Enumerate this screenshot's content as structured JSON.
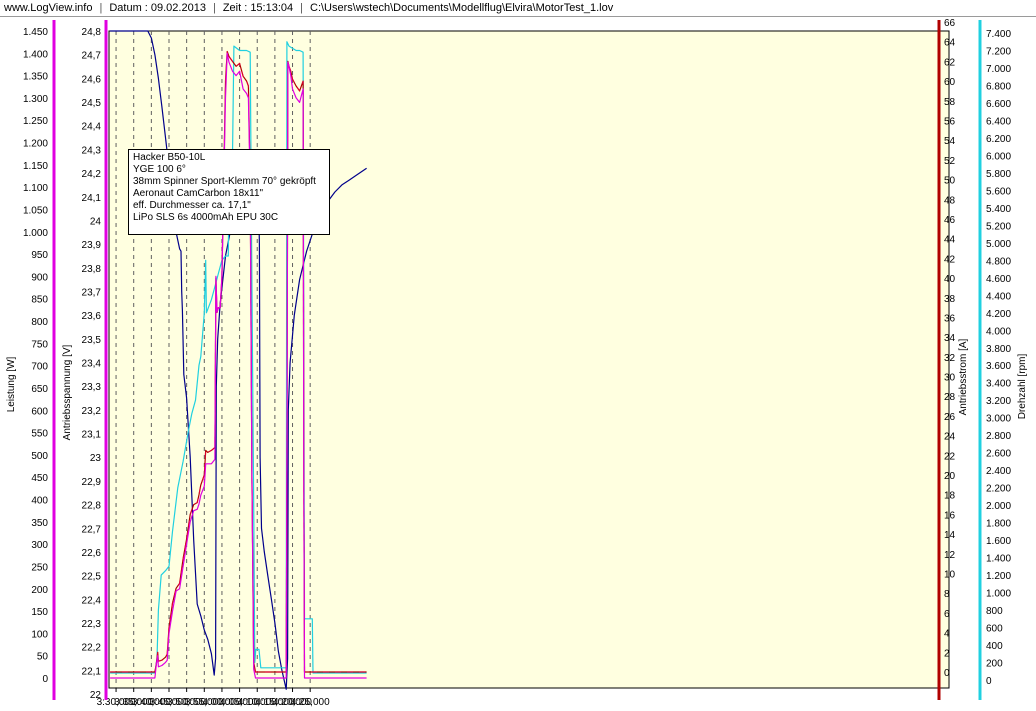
{
  "header": {
    "site": "www.LogView.info",
    "date": "Datum : 09.02.2013",
    "time": "Zeit : 15:13:04",
    "path": "C:\\Users\\wstech\\Documents\\Modellflug\\Elvira\\MotorTest_1.lov"
  },
  "infobox": {
    "lines": [
      "Hacker B50-10L",
      "YGE 100 6°",
      "38mm Spinner Sport-Klemm 70° gekröpft",
      "Aeronaut CamCarbon 18x11\"",
      "eff. Durchmesser ca. 17,1\"",
      "LiPo SLS 6s 4000mAh EPU 30C"
    ]
  },
  "colors": {
    "plot_bg": "#FFFFE0",
    "power": "#E000E0",
    "voltage": "#00008B",
    "current": "#B00000",
    "current_dash": "#FF0050",
    "rpm": "#20D0E0",
    "grid": "#606060"
  },
  "chart_data": {
    "type": "line",
    "x_unit": "m:ss",
    "xlim": [
      208,
      446
    ],
    "x_ticks": [
      {
        "t": 210,
        "label": "3:30,000"
      },
      {
        "t": 215,
        "label": "3:35,000"
      },
      {
        "t": 220,
        "label": "3:40,000"
      },
      {
        "t": 225,
        "label": "3:45,000"
      },
      {
        "t": 230,
        "label": "3:50,000"
      },
      {
        "t": 235,
        "label": "3:55,000"
      },
      {
        "t": 240,
        "label": "4:00,000"
      },
      {
        "t": 245,
        "label": "4:05,000"
      },
      {
        "t": 250,
        "label": "4:10,000"
      },
      {
        "t": 255,
        "label": "4:15,000"
      },
      {
        "t": 260,
        "label": "4:20,000"
      },
      {
        "t": 265,
        "label": "4:25,000"
      }
    ],
    "axes": {
      "power": {
        "label": "Leistung [W]",
        "ylim": [
          0,
          1450
        ],
        "ticks": [
          0,
          50,
          100,
          150,
          200,
          250,
          300,
          350,
          400,
          450,
          500,
          550,
          600,
          650,
          700,
          750,
          800,
          850,
          900,
          950,
          "1.000",
          "1.050",
          "1.100",
          "1.150",
          "1.200",
          "1.250",
          "1.300",
          "1.350",
          "1.400",
          "1.450"
        ]
      },
      "voltage": {
        "label": "Antriebsspannung [V]",
        "ylim": [
          22.0,
          24.8
        ],
        "ticks": [
          "22",
          "22,1",
          "22,2",
          "22,3",
          "22,4",
          "22,5",
          "22,6",
          "22,7",
          "22,8",
          "22,9",
          "23",
          "23,1",
          "23,2",
          "23,3",
          "23,4",
          "23,5",
          "23,6",
          "23,7",
          "23,8",
          "23,9",
          "24",
          "24,1",
          "24,2",
          "24,3",
          "24,4",
          "24,5",
          "24,6",
          "24,7",
          "24,8"
        ]
      },
      "current": {
        "label": "Antriebsstrom [A]",
        "ylim": [
          0,
          66
        ],
        "ticks": [
          "0",
          "2",
          "4",
          "6",
          "8",
          "10",
          "12",
          "14",
          "16",
          "18",
          "20",
          "22",
          "24",
          "26",
          "28",
          "30",
          "32",
          "34",
          "36",
          "38",
          "40",
          "42",
          "44",
          "46",
          "48",
          "50",
          "52",
          "54",
          "56",
          "58",
          "60",
          "62",
          "64",
          "66"
        ]
      },
      "rpm": {
        "label": "Drehzahl [rpm]",
        "ylim": [
          0,
          7400
        ],
        "ticks": [
          "0",
          "200",
          "400",
          "600",
          "800",
          "1.000",
          "1.200",
          "1.400",
          "1.600",
          "1.800",
          "2.000",
          "2.200",
          "2.400",
          "2.600",
          "2.800",
          "3.000",
          "3.200",
          "3.400",
          "3.600",
          "3.800",
          "4.000",
          "4.200",
          "4.400",
          "4.600",
          "4.800",
          "5.000",
          "5.200",
          "5.400",
          "5.600",
          "5.800",
          "6.000",
          "6.200",
          "6.400",
          "6.600",
          "6.800",
          "7.000",
          "7.200",
          "7.400"
        ]
      }
    },
    "series": [
      {
        "key": "voltage",
        "axis": "voltage",
        "points": [
          [
            208.3,
            24.8
          ],
          [
            219,
            24.8
          ],
          [
            220,
            24.77
          ],
          [
            221,
            24.7
          ],
          [
            222,
            24.6
          ],
          [
            223,
            24.48
          ],
          [
            224,
            24.35
          ],
          [
            225,
            24.22
          ],
          [
            226,
            24.08
          ],
          [
            227,
            23.95
          ],
          [
            228,
            23.88
          ],
          [
            228.4,
            23.87
          ],
          [
            228.6,
            23.7
          ],
          [
            228.8,
            23.62
          ],
          [
            229.2,
            23.35
          ],
          [
            230,
            23.25
          ],
          [
            231,
            23.0
          ],
          [
            232,
            22.65
          ],
          [
            233,
            22.38
          ],
          [
            234,
            22.33
          ],
          [
            235,
            22.27
          ],
          [
            236,
            22.23
          ],
          [
            237,
            22.17
          ],
          [
            237.8,
            22.08
          ],
          [
            238.2,
            22.15
          ],
          [
            238.4,
            23.3
          ],
          [
            238.8,
            23.5
          ],
          [
            239.5,
            23.65
          ],
          [
            241,
            23.85
          ],
          [
            243,
            24.0
          ],
          [
            245,
            24.1
          ],
          [
            247,
            24.16
          ],
          [
            249,
            24.2
          ],
          [
            250.2,
            24.22
          ],
          [
            250.6,
            23.9
          ],
          [
            250.8,
            23.0
          ],
          [
            251.2,
            22.7
          ],
          [
            252,
            22.6
          ],
          [
            253,
            22.5
          ],
          [
            254,
            22.4
          ],
          [
            255,
            22.3
          ],
          [
            256,
            22.18
          ],
          [
            257,
            22.1
          ],
          [
            258.2,
            22.02
          ],
          [
            258.6,
            22.15
          ],
          [
            258.8,
            23.2
          ],
          [
            259.3,
            23.4
          ],
          [
            260.5,
            23.6
          ],
          [
            262,
            23.75
          ],
          [
            264,
            23.87
          ],
          [
            266,
            23.96
          ],
          [
            268,
            24.03
          ],
          [
            270,
            24.08
          ],
          [
            272,
            24.12
          ],
          [
            274,
            24.15
          ],
          [
            276,
            24.17
          ],
          [
            278,
            24.19
          ],
          [
            281,
            24.22
          ]
        ]
      },
      {
        "key": "rpm",
        "axis": "rpm",
        "points": [
          [
            208.3,
            80
          ],
          [
            221,
            80
          ],
          [
            221.6,
            250
          ],
          [
            222,
            800
          ],
          [
            222.8,
            1200
          ],
          [
            224,
            1250
          ],
          [
            225,
            1300
          ],
          [
            226,
            1700
          ],
          [
            227.5,
            2200
          ],
          [
            229,
            2500
          ],
          [
            230.5,
            2850
          ],
          [
            231.5,
            3050
          ],
          [
            232.5,
            3200
          ],
          [
            233.5,
            3600
          ],
          [
            234,
            3700
          ],
          [
            235,
            4200
          ],
          [
            235.4,
            4800
          ],
          [
            235.6,
            4200
          ],
          [
            237,
            4350
          ],
          [
            238,
            4500
          ],
          [
            239,
            4650
          ],
          [
            240,
            4800
          ],
          [
            241,
            4850
          ],
          [
            241.8,
            4850
          ],
          [
            242,
            5700
          ],
          [
            242.4,
            5850
          ],
          [
            243,
            6000
          ],
          [
            243.4,
            7250
          ],
          [
            245,
            7200
          ],
          [
            247,
            7200
          ],
          [
            248,
            7180
          ],
          [
            248.4,
            5000
          ],
          [
            249,
            2000
          ],
          [
            249.3,
            200
          ],
          [
            249.6,
            350
          ],
          [
            250.5,
            350
          ],
          [
            251,
            140
          ],
          [
            253,
            140
          ],
          [
            258.2,
            140
          ],
          [
            258.4,
            7300
          ],
          [
            259,
            7250
          ],
          [
            261,
            7200
          ],
          [
            262,
            7200
          ],
          [
            263,
            7180
          ],
          [
            263.4,
            700
          ],
          [
            265.6,
            700
          ],
          [
            265.8,
            80
          ],
          [
            281,
            80
          ]
        ]
      },
      {
        "key": "current",
        "axis": "current",
        "points": [
          [
            208.3,
            0
          ],
          [
            221,
            0
          ],
          [
            221.4,
            0.8
          ],
          [
            221.8,
            2
          ],
          [
            222,
            1.1
          ],
          [
            223,
            1.2
          ],
          [
            224,
            1.5
          ],
          [
            224.5,
            1.8
          ],
          [
            225,
            4.5
          ],
          [
            226,
            7
          ],
          [
            227,
            8.5
          ],
          [
            228,
            9
          ],
          [
            229,
            11.5
          ],
          [
            230,
            13.5
          ],
          [
            231,
            16
          ],
          [
            232,
            17
          ],
          [
            233,
            17.2
          ],
          [
            233.5,
            18
          ],
          [
            234,
            19
          ],
          [
            235,
            20
          ],
          [
            235.4,
            22.5
          ],
          [
            236,
            22.3
          ],
          [
            237,
            22.5
          ],
          [
            238,
            22.8
          ],
          [
            238.3,
            40
          ],
          [
            238.6,
            36.5
          ],
          [
            239,
            37
          ],
          [
            239.5,
            37
          ],
          [
            240,
            40
          ],
          [
            240.5,
            50
          ],
          [
            241,
            60
          ],
          [
            241.5,
            63
          ],
          [
            242,
            62.5
          ],
          [
            243,
            62
          ],
          [
            244,
            61.5
          ],
          [
            245,
            61.8
          ],
          [
            246,
            60.5
          ],
          [
            247,
            60
          ],
          [
            247.5,
            59.5
          ],
          [
            248,
            50
          ],
          [
            248.5,
            20
          ],
          [
            249,
            1
          ],
          [
            249.5,
            0
          ],
          [
            258.2,
            0
          ],
          [
            258.4,
            20
          ],
          [
            258.7,
            62
          ],
          [
            259,
            61.5
          ],
          [
            259.5,
            61
          ],
          [
            260,
            60.2
          ],
          [
            261,
            59.5
          ],
          [
            262,
            59
          ],
          [
            263,
            60
          ],
          [
            263.2,
            20
          ],
          [
            263.4,
            0
          ],
          [
            265,
            0
          ],
          [
            281,
            0
          ]
        ]
      },
      {
        "key": "power",
        "axis": "power",
        "points": [
          [
            208.3,
            0
          ],
          [
            221,
            0
          ],
          [
            221.4,
            30
          ],
          [
            221.8,
            50
          ],
          [
            222,
            25
          ],
          [
            223,
            28
          ],
          [
            224,
            35
          ],
          [
            224.5,
            40
          ],
          [
            225,
            100
          ],
          [
            226,
            150
          ],
          [
            227,
            195
          ],
          [
            228,
            200
          ],
          [
            229,
            250
          ],
          [
            230,
            300
          ],
          [
            231,
            350
          ],
          [
            232,
            375
          ],
          [
            233,
            378
          ],
          [
            233.5,
            390
          ],
          [
            234,
            410
          ],
          [
            235,
            430
          ],
          [
            235.4,
            480
          ],
          [
            236,
            480
          ],
          [
            237,
            480
          ],
          [
            238,
            490
          ],
          [
            238.3,
            900
          ],
          [
            238.6,
            820
          ],
          [
            239,
            830
          ],
          [
            239.5,
            830
          ],
          [
            240,
            900
          ],
          [
            240.5,
            1100
          ],
          [
            241,
            1300
          ],
          [
            241.5,
            1400
          ],
          [
            242,
            1380
          ],
          [
            243,
            1360
          ],
          [
            244,
            1350
          ],
          [
            245,
            1360
          ],
          [
            246,
            1320
          ],
          [
            247,
            1310
          ],
          [
            247.5,
            1300
          ],
          [
            248,
            1100
          ],
          [
            248.5,
            450
          ],
          [
            249,
            20
          ],
          [
            249.5,
            0
          ],
          [
            258.2,
            0
          ],
          [
            258.4,
            450
          ],
          [
            258.7,
            1380
          ],
          [
            259,
            1370
          ],
          [
            259.5,
            1350
          ],
          [
            260,
            1320
          ],
          [
            261,
            1300
          ],
          [
            262,
            1290
          ],
          [
            263,
            1320
          ],
          [
            263.2,
            450
          ],
          [
            263.4,
            0
          ],
          [
            265,
            0
          ],
          [
            281,
            0
          ]
        ]
      }
    ]
  }
}
